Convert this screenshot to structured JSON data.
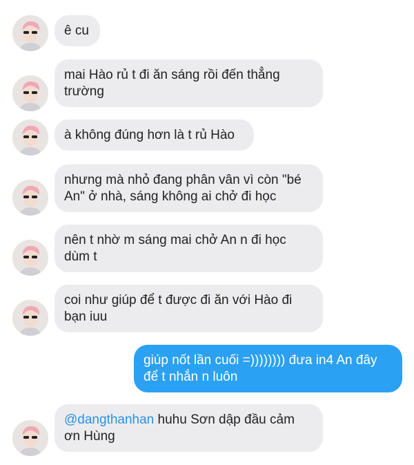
{
  "conversation": {
    "contact_avatar": "profile-photo",
    "colors": {
      "incoming_bubble": "#ececef",
      "outgoing_bubble": "#2aa1f3",
      "mention": "#2a91e6"
    },
    "messages": [
      {
        "direction": "incoming",
        "text": "ê cu"
      },
      {
        "direction": "incoming",
        "text": "mai Hào rủ t đi ăn sáng rồi đến thẳng trường"
      },
      {
        "direction": "incoming",
        "text": "à không đúng hơn là t rủ Hào"
      },
      {
        "direction": "incoming",
        "text": "nhưng mà nhỏ đang phân vân vì còn \"bé An\" ở nhà, sáng không ai chở đi học"
      },
      {
        "direction": "incoming",
        "text": "nên t nhờ m sáng mai chở An n đi học dùm t"
      },
      {
        "direction": "incoming",
        "text": "coi như giúp để t được đi ăn với Hào đi bạn iuu"
      },
      {
        "direction": "outgoing",
        "text": "giúp nốt lần cuối =)))))))) đưa in4 An đây để t nhắn n luôn"
      },
      {
        "direction": "incoming",
        "mention": "@dangthanhan",
        "text": " huhu Sơn dập đầu cảm ơn Hùng"
      }
    ]
  }
}
